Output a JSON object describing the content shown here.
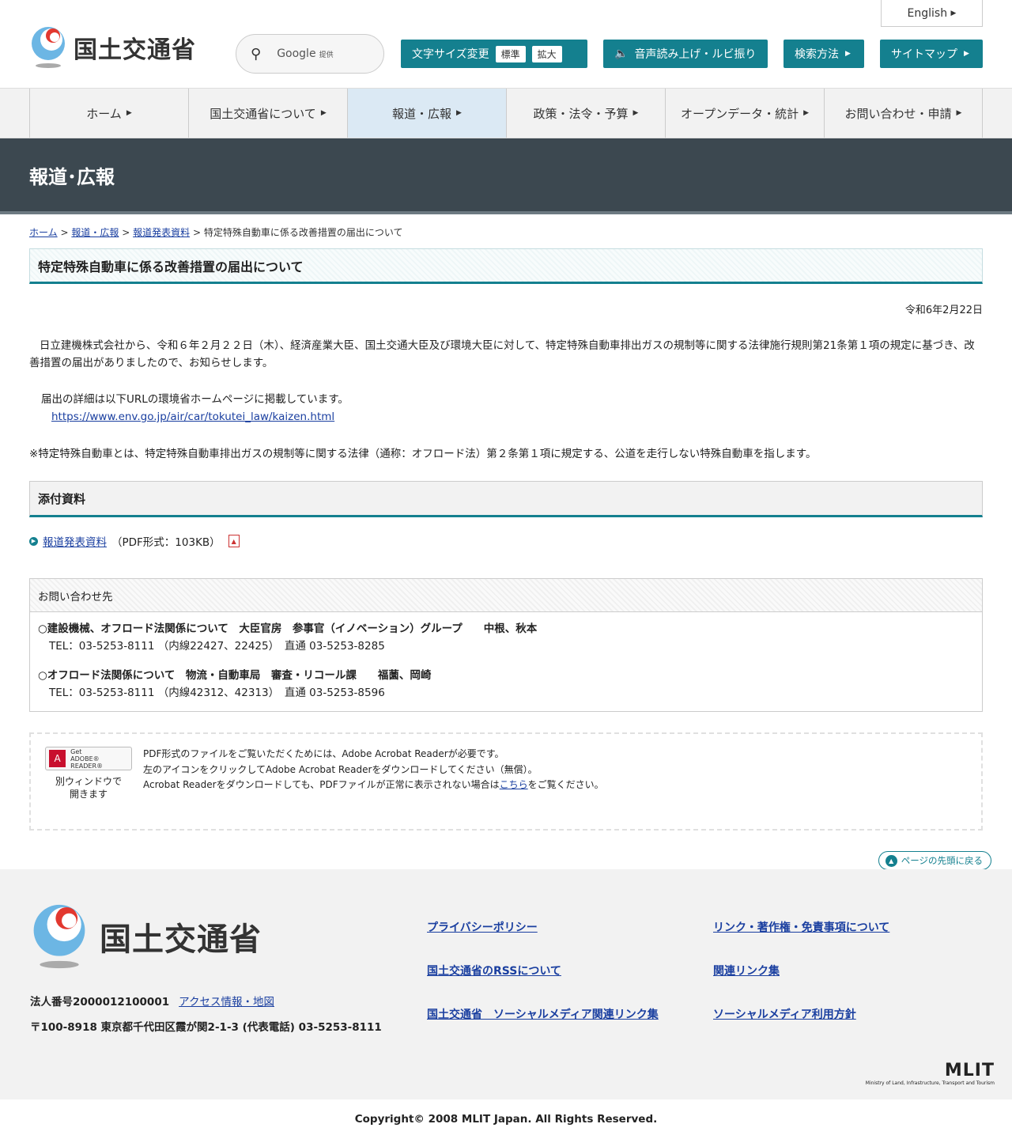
{
  "header": {
    "logo_text": "国土交通省",
    "search_label": "Google",
    "search_sub": "提供",
    "font_size_label": "文字サイズ変更",
    "font_standard": "標準",
    "font_large": "拡大",
    "voice_label": "音声読み上げ・ルビ振り",
    "search_method": "検索方法",
    "sitemap": "サイトマップ",
    "english": "English"
  },
  "nav": [
    {
      "label": "ホーム"
    },
    {
      "label": "国土交通省について"
    },
    {
      "label": "報道・広報"
    },
    {
      "label": "政策・法令・予算"
    },
    {
      "label": "オープンデータ・統計"
    },
    {
      "label": "お問い合わせ・申請"
    }
  ],
  "banner_title": "報道･広報",
  "breadcrumb": {
    "home": "ホーム",
    "press": "報道・広報",
    "release": "報道発表資料",
    "current": "特定特殊自動車に係る改善措置の届出について",
    "sep": ">"
  },
  "article": {
    "title": "特定特殊自動車に係る改善措置の届出について",
    "date": "令和6年2月22日",
    "para1": "日立建機株式会社から、令和６年２月２２日（木）、経済産業大臣、国土交通大臣及び環境大臣に対して、特定特殊自動車排出ガスの規制等に関する法律施行規則第21条第１項の規定に基づき、改善措置の届出がありましたので、お知らせします。",
    "para2": "届出の詳細は以下URLの環境省ホームページに掲載しています。",
    "url": "https://www.env.go.jp/air/car/tokutei_law/kaizen.html",
    "note": "※特定特殊自動車とは、特定特殊自動車排出ガスの規制等に関する法律（通称：オフロード法）第２条第１項に規定する、公道を走行しない特殊自動車を指します。"
  },
  "attachments": {
    "heading": "添付資料",
    "link": "報道発表資料",
    "info": "（PDF形式：103KB）"
  },
  "contact": {
    "heading": "お問い合わせ先",
    "entries": [
      {
        "name": "○建設機械、オフロード法関係について　大臣官房　参事官（イノベーション）グループ　　中根、秋本",
        "tel": "TEL：03-5253-8111 （内線22427、22425）　直通 03-5253-8285"
      },
      {
        "name": "○オフロード法関係について　物流・自動車局　審査・リコール課　　福薗、岡崎",
        "tel": "TEL：03-5253-8111 （内線42312、42313）　直通 03-5253-8596"
      }
    ]
  },
  "reader": {
    "badge_get": "Get",
    "badge_name": "ADOBE® READER®",
    "window_note_1": "別ウィンドウで",
    "window_note_2": "開きます",
    "line1": "PDF形式のファイルをご覧いただくためには、Adobe Acrobat Readerが必要です。",
    "line2": "左のアイコンをクリックしてAdobe Acrobat Readerをダウンロードしてください（無償）。",
    "line3_pre": "Acrobat Readerをダウンロードしても、PDFファイルが正常に表示されない場合は",
    "line3_link": "こちら",
    "line3_post": "をご覧ください。"
  },
  "totop": "ページの先頭に戻る",
  "footer": {
    "logo_text": "国土交通省",
    "corp_no": "法人番号2000012100001",
    "access": "アクセス情報・地図",
    "address": "〒100-8918 東京都千代田区霞が関2-1-3 (代表電話) 03-5253-8111",
    "links": [
      "プライバシーポリシー",
      "リンク・著作権・免責事項について",
      "国土交通省のRSSについて",
      "関連リンク集",
      "国土交通省　ソーシャルメディア関連リンク集",
      "ソーシャルメディア利用方針"
    ],
    "mlit": "MLIT",
    "mlit_sub": "Ministry of Land, Infrastructure, Transport and Tourism",
    "copyright": "Copyright© 2008 MLIT Japan. All Rights Reserved."
  },
  "colors": {
    "accent": "#14808f",
    "banner": "#3c4850",
    "link": "#1a3fa0"
  }
}
